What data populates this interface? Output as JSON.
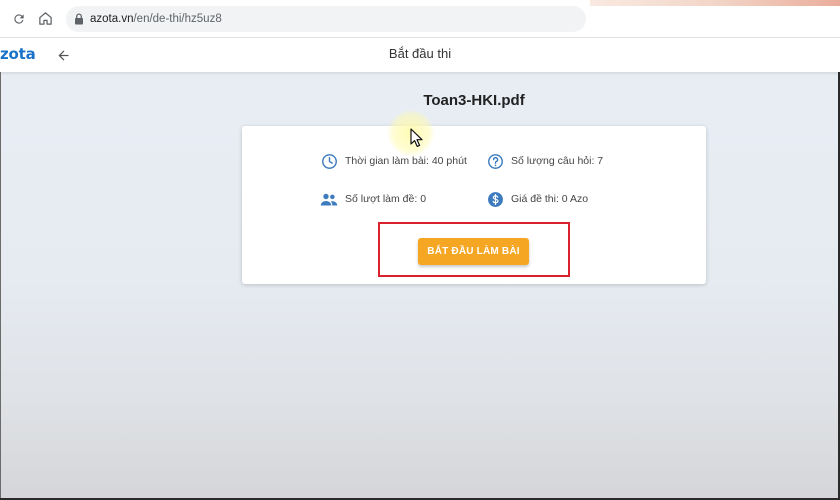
{
  "browser": {
    "url_host": "azota.vn",
    "url_path": "/en/de-thi/hz5uz8",
    "icons": [
      "reload-icon",
      "home-icon",
      "lock-icon"
    ]
  },
  "header": {
    "logo_text": "zota",
    "title": "Bắt đầu thi",
    "back_icon": "arrow-left-icon"
  },
  "exam": {
    "file_name": "Toan3-HKI.pdf",
    "info": {
      "time": "Thời gian làm bài: 40 phút",
      "questions": "Số lượng câu hỏi: 7",
      "attempts": "Số lượt làm đề: 0",
      "price": "Giá đề thi: 0 Azo"
    },
    "start_button_label": "BẮT ĐẦU LÀM BÀI"
  },
  "colors": {
    "brand_blue": "#1a73c8",
    "icon_blue": "#3d7bbf",
    "button_orange": "#f5a623",
    "highlight_red": "#d9222b"
  }
}
